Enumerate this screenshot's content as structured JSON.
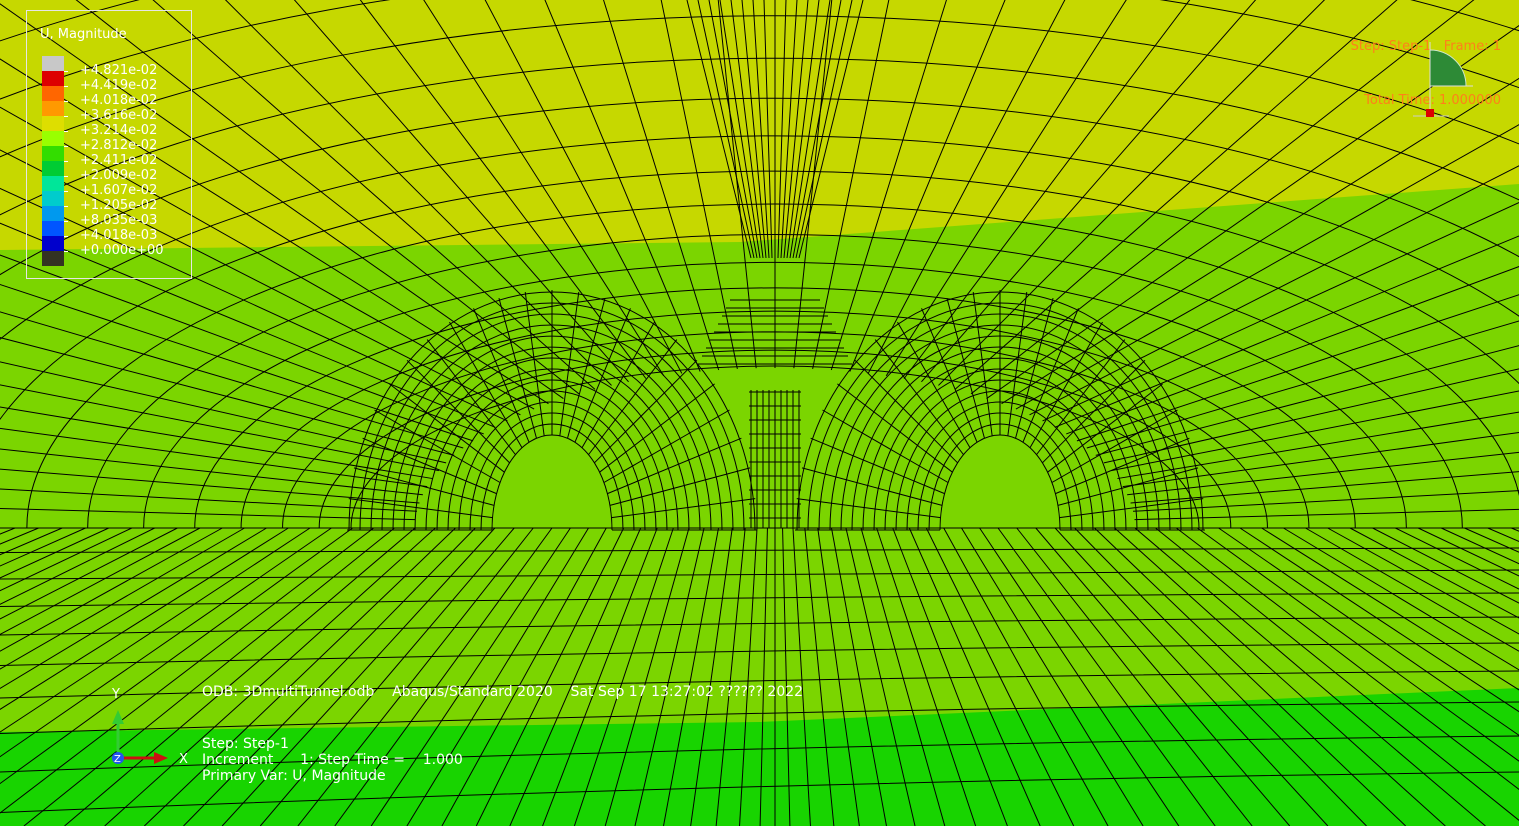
{
  "legend": {
    "title": "U, Magnitude",
    "values": [
      "+4.821e-02",
      "+4.419e-02",
      "+4.018e-02",
      "+3.616e-02",
      "+3.214e-02",
      "+2.812e-02",
      "+2.411e-02",
      "+2.009e-02",
      "+1.607e-02",
      "+1.205e-02",
      "+8.035e-03",
      "+4.018e-03",
      "+0.000e+00"
    ],
    "colors": [
      "#c8c8c8",
      "#dd0000",
      "#ff6600",
      "#ff9900",
      "#dede00",
      "#99ff00",
      "#33dd00",
      "#00cc33",
      "#00e699",
      "#00cccc",
      "#0099ee",
      "#0055ff",
      "#0000cc",
      "#333322"
    ]
  },
  "step_status": {
    "line1": "Step: Step-1   Frame: 1",
    "line2": "Total Time: 1.000000"
  },
  "triad": {
    "x": "X",
    "y": "Y",
    "z": "Z"
  },
  "info": {
    "odb": "ODB: 3DmultiTunnel.odb    Abaqus/Standard 2020    Sat Sep 17 13:27:02 ?????? 2022",
    "step": "Step: Step-1",
    "increment": "Increment      1: Step Time =    1.000",
    "primary_var": "Primary Var: U, Magnitude"
  },
  "contour_colors": {
    "band_top": "#c6d800",
    "band_mid": "#7bd500",
    "band_low": "#18d400",
    "mesh_line": "#000000"
  }
}
